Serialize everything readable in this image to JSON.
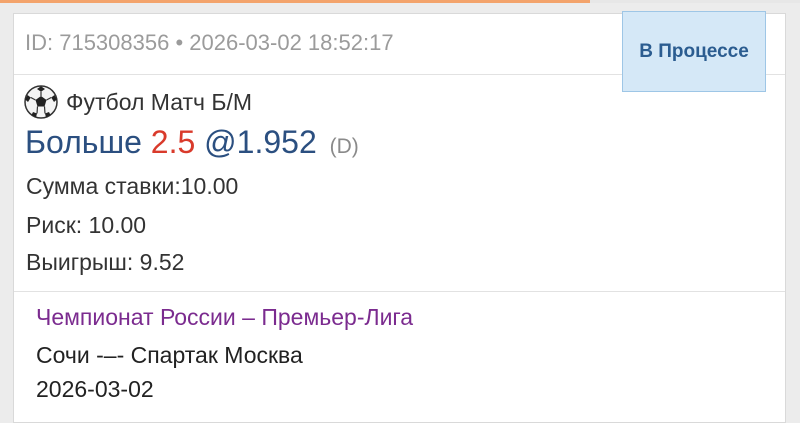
{
  "header": {
    "bet_meta": "ID: 715308356 • 2026-03-02 18:52:17",
    "status": "В Процессе"
  },
  "sport": {
    "icon": "soccer-ball-icon",
    "label": "Футбол Матч Б/М"
  },
  "selection": {
    "pick": "Больше",
    "handicap": "2.5",
    "odds": "@1.952",
    "odds_format": "(D)"
  },
  "details": {
    "stake": "Сумма ставки:10.00",
    "risk": "Риск: 10.00",
    "win": "Выигрыш: 9.52"
  },
  "event": {
    "league": "Чемпионат России – Премьер-Лига",
    "match": "Сочи -–- Спартак Москва",
    "date": "2026-03-02"
  },
  "colors": {
    "accent_orange": "#f3a36b",
    "status_bg": "#d5e8f7",
    "status_text": "#2b5c90",
    "selection_blue": "#2b4f80",
    "handicap_red": "#d93a2b",
    "league_purple": "#7b2b8f"
  }
}
